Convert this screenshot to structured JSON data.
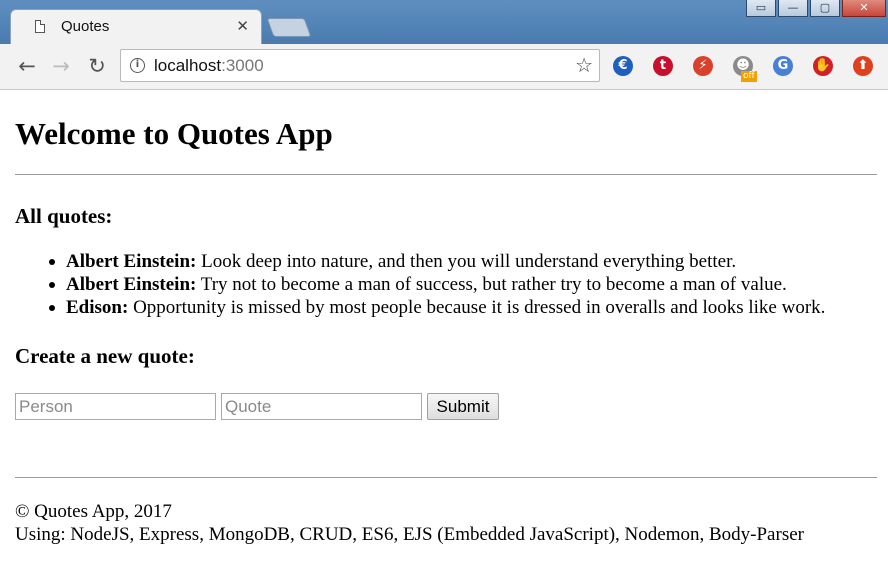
{
  "browser": {
    "tab_title": "Quotes",
    "tab_close": "✕",
    "window_controls": [
      "▭",
      "—",
      "▢",
      "✕"
    ],
    "url_host": "localhost",
    "url_port": ":3000",
    "extensions": [
      {
        "name": "euro-extension-icon",
        "glyph": "€",
        "color": "#1f5fbf"
      },
      {
        "name": "t-extension-icon",
        "glyph": "t",
        "color": "#c8102e"
      },
      {
        "name": "plug-extension-icon",
        "glyph": "⚡",
        "color": "#d9412c"
      },
      {
        "name": "ghost-extension-icon",
        "glyph": "☻",
        "color": "#8a8a8a"
      },
      {
        "name": "translate-extension-icon",
        "glyph": "G",
        "color": "#4a7fd6"
      },
      {
        "name": "hand-extension-icon",
        "glyph": "✋",
        "color": "#d0202a"
      },
      {
        "name": "upload-extension-icon",
        "glyph": "⬆",
        "color": "#e0401e"
      }
    ],
    "extension_badge": "off"
  },
  "page": {
    "title": "Welcome to Quotes App",
    "all_quotes_heading": "All quotes:",
    "quotes": [
      {
        "person": "Albert Einstein:",
        "text": " Look deep into nature, and then you will understand everything better."
      },
      {
        "person": "Albert Einstein:",
        "text": " Try not to become a man of success, but rather try to become a man of value."
      },
      {
        "person": "Edison:",
        "text": " Opportunity is missed by most people because it is dressed in overalls and looks like work."
      }
    ],
    "create_heading": "Create a new quote:",
    "form": {
      "person_placeholder": "Person",
      "quote_placeholder": "Quote",
      "submit_label": "Submit"
    },
    "footer": {
      "copyright": "© Quotes App, 2017",
      "tech": "Using: NodeJS, Express, MongoDB, CRUD, ES6, EJS (Embedded JavaScript), Nodemon, Body-Parser"
    }
  }
}
